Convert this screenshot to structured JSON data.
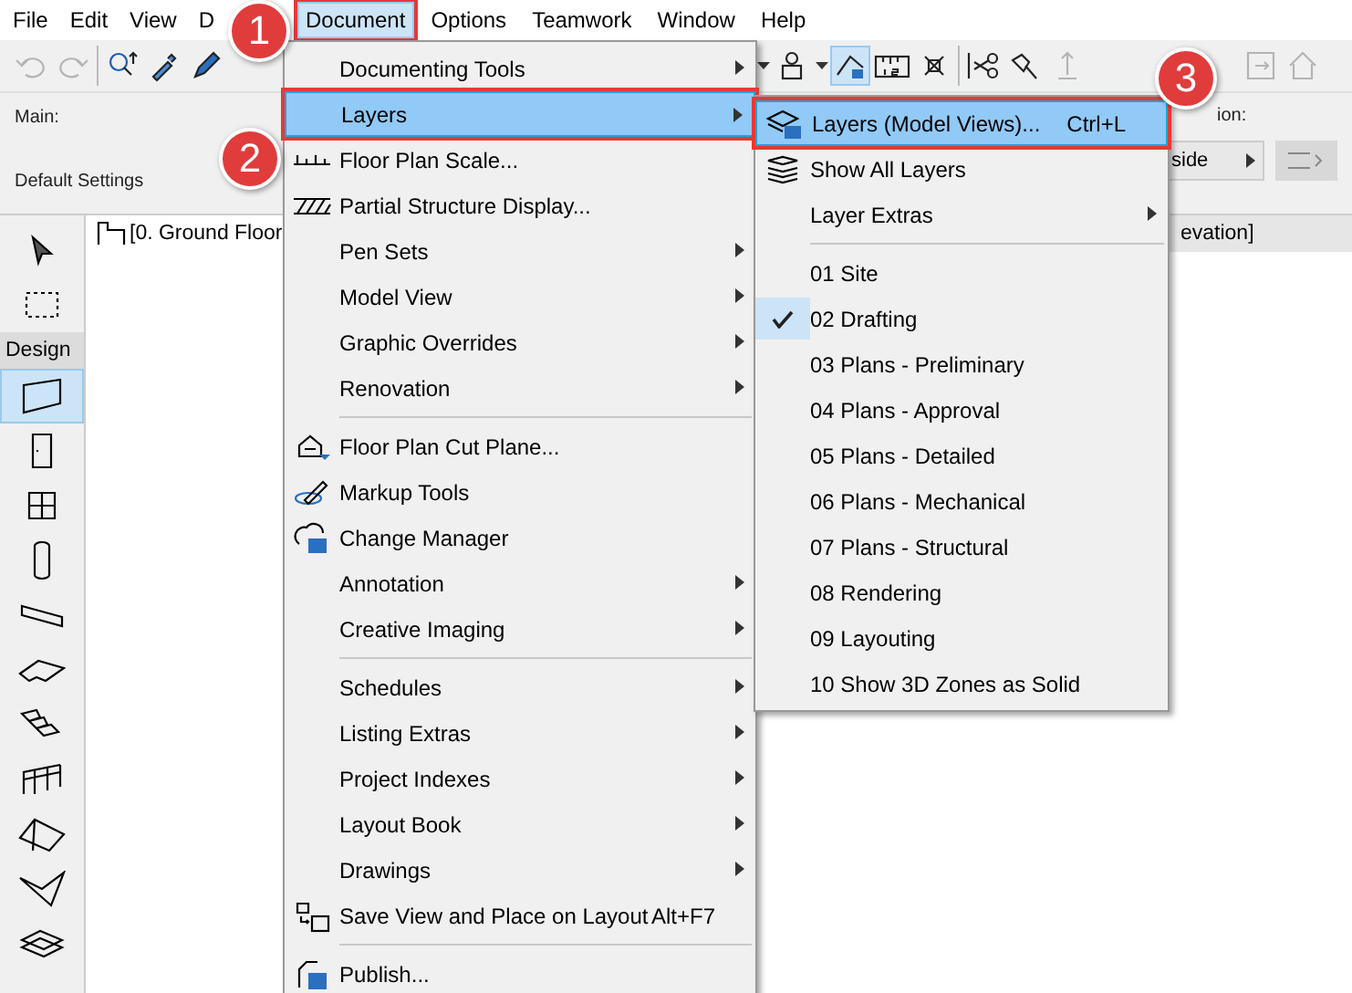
{
  "menu_bar": [
    {
      "label": "File",
      "selected": false,
      "callout": false
    },
    {
      "label": "Edit",
      "selected": false,
      "callout": false
    },
    {
      "label": "View",
      "selected": false,
      "callout": false
    },
    {
      "label": "D",
      "selected": false,
      "callout": false
    },
    {
      "label": "Document",
      "selected": true,
      "callout": true
    },
    {
      "label": "Options",
      "selected": false,
      "callout": false
    },
    {
      "label": "Teamwork",
      "selected": false,
      "callout": false
    },
    {
      "label": "Window",
      "selected": false,
      "callout": false
    },
    {
      "label": "Help",
      "selected": false,
      "callout": false
    }
  ],
  "toolbar": {
    "groups": [
      [
        {
          "kind": "undo",
          "disabled": true,
          "pressed": false
        },
        {
          "kind": "redo",
          "disabled": true,
          "pressed": false
        }
      ],
      [
        {
          "kind": "pick",
          "disabled": false,
          "pressed": false
        },
        {
          "kind": "dropper",
          "disabled": false,
          "pressed": false
        },
        {
          "kind": "pen",
          "disabled": false,
          "pressed": false
        }
      ],
      [
        {
          "kind": "caret"
        },
        {
          "kind": "person",
          "disabled": false,
          "pressed": false
        },
        {
          "kind": "caret"
        },
        {
          "kind": "layers",
          "disabled": false,
          "pressed": true
        },
        {
          "kind": "ruler",
          "disabled": false,
          "pressed": false
        },
        {
          "kind": "cross",
          "disabled": false,
          "pressed": false
        }
      ],
      [
        {
          "kind": "scissors",
          "disabled": false,
          "pressed": false
        },
        {
          "kind": "wand",
          "disabled": false,
          "pressed": false
        },
        {
          "kind": "elevate",
          "disabled": true,
          "pressed": false
        }
      ],
      [
        {
          "kind": "frame",
          "disabled": true,
          "pressed": false
        },
        {
          "kind": "home",
          "disabled": true,
          "pressed": false
        }
      ]
    ]
  },
  "info_box": {
    "title": "Main:",
    "settings": "Default Settings",
    "right_label": "ion:",
    "right_button": "side"
  },
  "toolbox": {
    "select_tools": [
      {
        "kind": "arrow",
        "selected": false
      },
      {
        "kind": "marquee",
        "selected": false
      }
    ],
    "header": "Design",
    "tools": [
      {
        "kind": "wall",
        "selected": true
      },
      {
        "kind": "door",
        "selected": false
      },
      {
        "kind": "window",
        "selected": false
      },
      {
        "kind": "column",
        "selected": false
      },
      {
        "kind": "beam",
        "selected": false
      },
      {
        "kind": "slab",
        "selected": false
      },
      {
        "kind": "stair",
        "selected": false
      },
      {
        "kind": "railing",
        "selected": false
      },
      {
        "kind": "roof",
        "selected": false
      },
      {
        "kind": "shell",
        "selected": false
      },
      {
        "kind": "mesh",
        "selected": false
      }
    ]
  },
  "view_tabs": [
    {
      "label": "[0. Ground Floor",
      "selected": true
    },
    {
      "label": "evation]",
      "selected": false
    }
  ],
  "document_menu": [
    {
      "kind": "item",
      "label": "Documenting Tools",
      "submenu": true,
      "selected": false,
      "callout": false
    },
    {
      "kind": "item",
      "label": "Layers",
      "submenu": true,
      "selected": true,
      "callout": true
    },
    {
      "kind": "item",
      "label": "Floor Plan Scale...",
      "submenu": false,
      "selected": false,
      "callout": false
    },
    {
      "kind": "item",
      "label": "Partial Structure Display...",
      "submenu": false,
      "selected": false,
      "callout": false
    },
    {
      "kind": "item",
      "label": "Pen Sets",
      "submenu": true,
      "selected": false,
      "callout": false
    },
    {
      "kind": "item",
      "label": "Model View",
      "submenu": true,
      "selected": false,
      "callout": false
    },
    {
      "kind": "item",
      "label": "Graphic Overrides",
      "submenu": true,
      "selected": false,
      "callout": false
    },
    {
      "kind": "item",
      "label": "Renovation",
      "submenu": true,
      "selected": false,
      "callout": false
    },
    {
      "kind": "separator"
    },
    {
      "kind": "item",
      "label": "Floor Plan Cut Plane...",
      "submenu": false,
      "selected": false,
      "callout": false
    },
    {
      "kind": "item",
      "label": "Markup Tools",
      "submenu": false,
      "selected": false,
      "callout": false
    },
    {
      "kind": "item",
      "label": "Change Manager",
      "submenu": false,
      "selected": false,
      "callout": false
    },
    {
      "kind": "item",
      "label": "Annotation",
      "submenu": true,
      "selected": false,
      "callout": false
    },
    {
      "kind": "item",
      "label": "Creative Imaging",
      "submenu": true,
      "selected": false,
      "callout": false
    },
    {
      "kind": "separator"
    },
    {
      "kind": "item",
      "label": "Schedules",
      "submenu": true,
      "selected": false,
      "callout": false
    },
    {
      "kind": "item",
      "label": "Listing Extras",
      "submenu": true,
      "selected": false,
      "callout": false
    },
    {
      "kind": "item",
      "label": "Project Indexes",
      "submenu": true,
      "selected": false,
      "callout": false
    },
    {
      "kind": "item",
      "label": "Layout Book",
      "submenu": true,
      "selected": false,
      "callout": false
    },
    {
      "kind": "item",
      "label": "Drawings",
      "submenu": true,
      "selected": false,
      "callout": false
    },
    {
      "kind": "item",
      "label": "Save View and Place on Layout",
      "shortcut": "Alt+F7",
      "submenu": false,
      "selected": false,
      "callout": false
    },
    {
      "kind": "separator"
    },
    {
      "kind": "item",
      "label": "Publish...",
      "submenu": false,
      "selected": false,
      "callout": false
    }
  ],
  "layers_submenu": [
    {
      "kind": "item",
      "label": "Layers (Model Views)...",
      "shortcut": "Ctrl+L",
      "submenu": false,
      "checked": false,
      "selected": true,
      "callout": true
    },
    {
      "kind": "item",
      "label": "Show All Layers",
      "submenu": false,
      "checked": false,
      "selected": false,
      "callout": false
    },
    {
      "kind": "item",
      "label": "Layer Extras",
      "submenu": true,
      "checked": false,
      "selected": false,
      "callout": false
    },
    {
      "kind": "separator"
    },
    {
      "kind": "item",
      "label": "01 Site",
      "submenu": false,
      "checked": false,
      "selected": false,
      "callout": false
    },
    {
      "kind": "item",
      "label": "02 Drafting",
      "submenu": false,
      "checked": true,
      "selected": false,
      "callout": false
    },
    {
      "kind": "item",
      "label": "03 Plans - Preliminary",
      "submenu": false,
      "checked": false,
      "selected": false,
      "callout": false
    },
    {
      "kind": "item",
      "label": "04 Plans - Approval",
      "submenu": false,
      "checked": false,
      "selected": false,
      "callout": false
    },
    {
      "kind": "item",
      "label": "05 Plans - Detailed",
      "submenu": false,
      "checked": false,
      "selected": false,
      "callout": false
    },
    {
      "kind": "item",
      "label": "06 Plans - Mechanical",
      "submenu": false,
      "checked": false,
      "selected": false,
      "callout": false
    },
    {
      "kind": "item",
      "label": "07 Plans - Structural",
      "submenu": false,
      "checked": false,
      "selected": false,
      "callout": false
    },
    {
      "kind": "item",
      "label": "08 Rendering",
      "submenu": false,
      "checked": false,
      "selected": false,
      "callout": false
    },
    {
      "kind": "item",
      "label": "09 Layouting",
      "submenu": false,
      "checked": false,
      "selected": false,
      "callout": false
    },
    {
      "kind": "item",
      "label": "10 Show 3D Zones as Solid",
      "submenu": false,
      "checked": false,
      "selected": false,
      "callout": false
    }
  ],
  "step_badges": [
    "1",
    "2",
    "3"
  ]
}
